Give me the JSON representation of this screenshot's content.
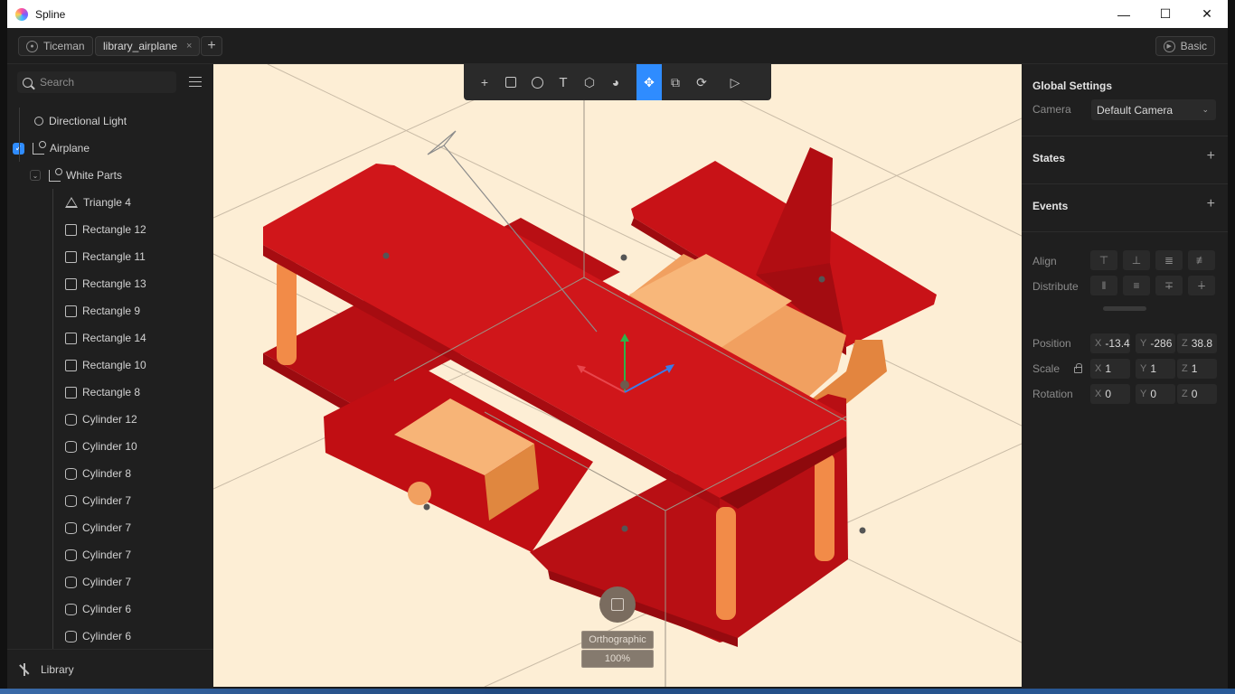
{
  "window": {
    "title": "Spline"
  },
  "topbar": {
    "user": "Ticeman",
    "tab": "library_airplane",
    "tab_close": "×",
    "add": "+",
    "mode": "Basic"
  },
  "search": {
    "placeholder": "Search"
  },
  "tree": [
    {
      "label": "Directional Light",
      "icon": "light-icon"
    },
    {
      "label": "Airplane",
      "icon": "group-icon",
      "checked": true
    },
    {
      "label": "White Parts",
      "icon": "group-icon",
      "expanded": true
    },
    {
      "label": "Triangle 4",
      "icon": "triangle-icon"
    },
    {
      "label": "Rectangle 12",
      "icon": "rectangle-icon"
    },
    {
      "label": "Rectangle 11",
      "icon": "rectangle-icon"
    },
    {
      "label": "Rectangle 13",
      "icon": "rectangle-icon"
    },
    {
      "label": "Rectangle 9",
      "icon": "rectangle-icon"
    },
    {
      "label": "Rectangle 14",
      "icon": "rectangle-icon"
    },
    {
      "label": "Rectangle 10",
      "icon": "rectangle-icon"
    },
    {
      "label": "Rectangle 8",
      "icon": "rectangle-icon"
    },
    {
      "label": "Cylinder 12",
      "icon": "cylinder-icon"
    },
    {
      "label": "Cylinder 10",
      "icon": "cylinder-icon"
    },
    {
      "label": "Cylinder 8",
      "icon": "cylinder-icon"
    },
    {
      "label": "Cylinder 7",
      "icon": "cylinder-icon"
    },
    {
      "label": "Cylinder 7",
      "icon": "cylinder-icon"
    },
    {
      "label": "Cylinder 7",
      "icon": "cylinder-icon"
    },
    {
      "label": "Cylinder 7",
      "icon": "cylinder-icon"
    },
    {
      "label": "Cylinder 6",
      "icon": "cylinder-icon"
    },
    {
      "label": "Cylinder 6",
      "icon": "cylinder-icon"
    }
  ],
  "library": {
    "label": "Library"
  },
  "toolbar": {
    "tools": [
      "add",
      "rectangle",
      "ellipse",
      "text",
      "cube",
      "sphere",
      "move",
      "scale",
      "rotate",
      "play"
    ],
    "active": "move"
  },
  "viewport": {
    "projection": "Orthographic",
    "zoom": "100%"
  },
  "right": {
    "global_settings": "Global Settings",
    "camera_label": "Camera",
    "camera_value": "Default Camera",
    "states": "States",
    "events": "Events",
    "align": "Align",
    "distribute": "Distribute",
    "position_label": "Position",
    "position": {
      "x": "-13.4",
      "y": "-286",
      "z": "38.8"
    },
    "scale_label": "Scale",
    "scale": {
      "x": "1",
      "y": "1",
      "z": "1"
    },
    "rotation_label": "Rotation",
    "rotation": {
      "x": "0",
      "y": "0",
      "z": "0"
    }
  },
  "colors": {
    "accent": "#2f8cff",
    "viewport_bg": "#fdeed5",
    "plane_red": "#d0161a",
    "plane_orange": "#f7b477"
  }
}
